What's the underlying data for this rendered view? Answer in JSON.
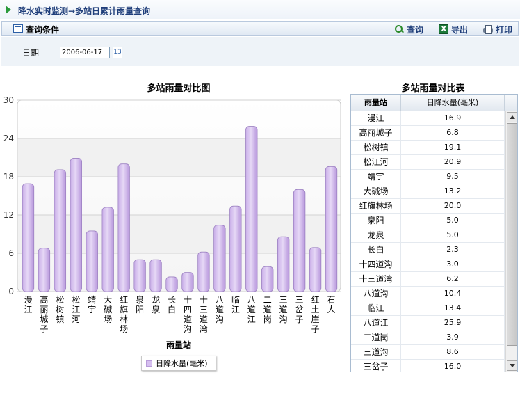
{
  "header": {
    "title": "降水实时监测→多站日累计雨量查询"
  },
  "toolbar": {
    "section_label": "查询条件",
    "query_label": "查询",
    "export_label": "导出",
    "print_label": "打印",
    "separator": "|"
  },
  "filter": {
    "date_label": "日期",
    "date_value": "2006-06-17",
    "calendar_label": "13"
  },
  "chart_data": {
    "type": "bar",
    "title": "多站雨量对比图",
    "xlabel": "雨量站",
    "ylabel": "",
    "ylim": [
      0,
      30
    ],
    "yticks": [
      "0",
      "6",
      "12",
      "18",
      "24",
      "30"
    ],
    "categories": [
      "漫江",
      "高丽城子",
      "松树镇",
      "松江河",
      "靖宇",
      "大碱场",
      "红旗林场",
      "泉阳",
      "龙泉",
      "长白",
      "十四道沟",
      "十三道湾",
      "八道沟",
      "临江",
      "八道江",
      "二道岗",
      "三道沟",
      "三岔子",
      "红土崖子",
      "石人"
    ],
    "series": [
      {
        "name": "日降水量(毫米)",
        "values": [
          16.9,
          6.8,
          19.1,
          20.9,
          9.5,
          13.2,
          20.0,
          5.0,
          5.0,
          2.3,
          3.0,
          6.2,
          10.4,
          13.4,
          25.9,
          3.9,
          8.6,
          16.0,
          6.9,
          19.6
        ]
      }
    ],
    "grid": true,
    "legend": "bottom",
    "bar_color": "#d6bff0"
  },
  "table": {
    "title": "多站雨量对比表",
    "columns": [
      "雨量站",
      "日降水量(毫米)"
    ],
    "rows": [
      [
        "漫江",
        "16.9"
      ],
      [
        "高丽城子",
        "6.8"
      ],
      [
        "松树镇",
        "19.1"
      ],
      [
        "松江河",
        "20.9"
      ],
      [
        "靖宇",
        "9.5"
      ],
      [
        "大碱场",
        "13.2"
      ],
      [
        "红旗林场",
        "20.0"
      ],
      [
        "泉阳",
        "5.0"
      ],
      [
        "龙泉",
        "5.0"
      ],
      [
        "长白",
        "2.3"
      ],
      [
        "十四道沟",
        "3.0"
      ],
      [
        "十三道湾",
        "6.2"
      ],
      [
        "八道沟",
        "10.4"
      ],
      [
        "临江",
        "13.4"
      ],
      [
        "八道江",
        "25.9"
      ],
      [
        "二道岗",
        "3.9"
      ],
      [
        "三道沟",
        "8.6"
      ],
      [
        "三岔子",
        "16.0"
      ]
    ]
  },
  "icons": {
    "header": "play-arrow-icon",
    "section": "list-icon",
    "query": "search-icon",
    "export": "excel-icon",
    "print": "printer-icon"
  }
}
